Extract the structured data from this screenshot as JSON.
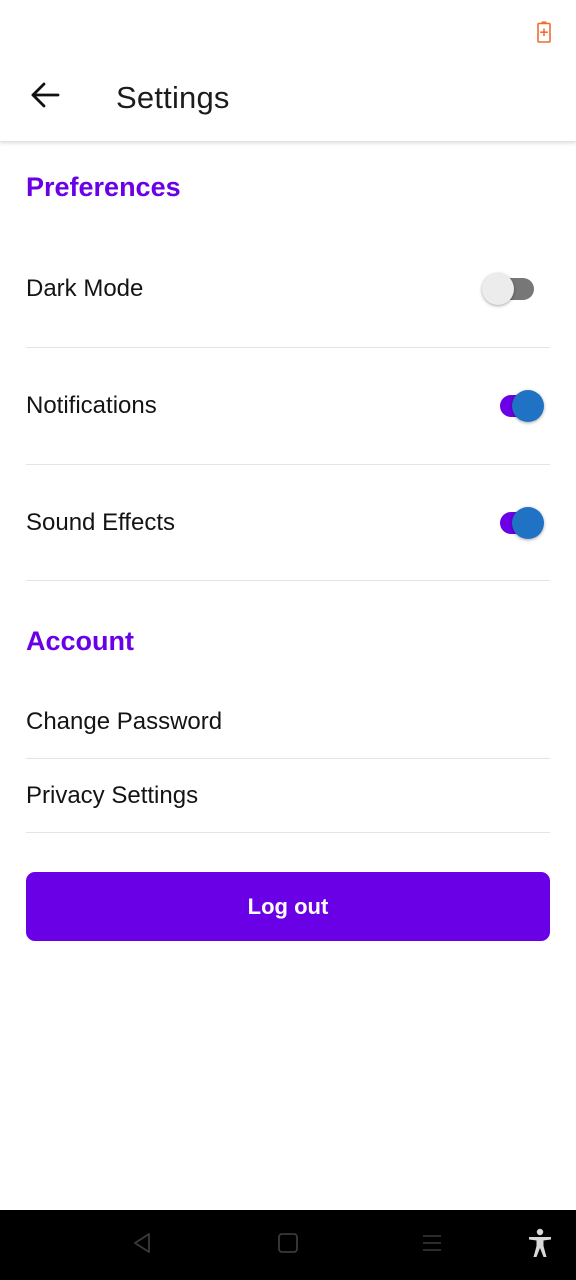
{
  "status_bar": {
    "battery_icon": "battery-charging-icon",
    "battery_color": "#f26a2e"
  },
  "app_bar": {
    "title": "Settings",
    "back_icon": "arrow-left-icon"
  },
  "preferences": {
    "title": "Preferences",
    "items": [
      {
        "label": "Dark Mode",
        "enabled": false
      },
      {
        "label": "Notifications",
        "enabled": true
      },
      {
        "label": "Sound Effects",
        "enabled": true
      }
    ]
  },
  "account": {
    "title": "Account",
    "items": [
      {
        "label": "Change Password"
      },
      {
        "label": "Privacy Settings"
      }
    ]
  },
  "logout_label": "Log out",
  "nav_bar": {
    "icons": [
      "back-triangle-icon",
      "home-square-icon",
      "recents-menu-icon",
      "accessibility-icon"
    ]
  },
  "colors": {
    "accent": "#6a00e6",
    "switch_thumb_on": "#2073c4",
    "switch_track_off": "#777777"
  }
}
